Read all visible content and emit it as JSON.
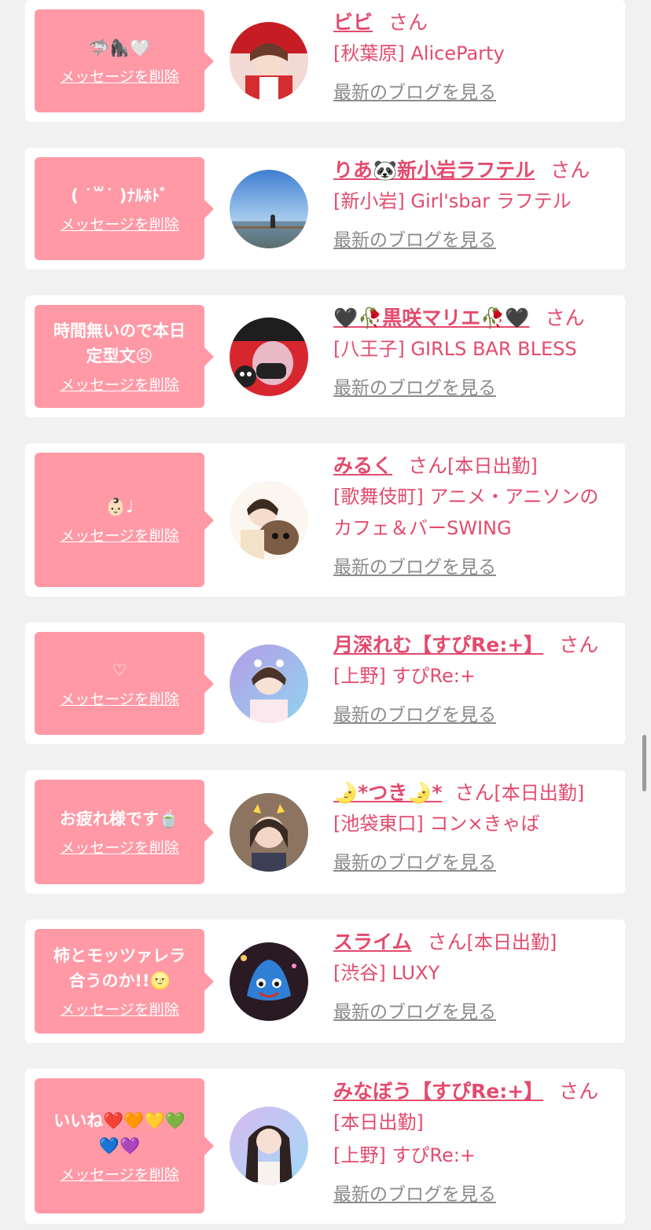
{
  "delete_label": "メッセージを削除",
  "blog_label": "最新のブログを見る",
  "san_label": "さん",
  "accent_color": "#e34b6e",
  "bubble_color": "#ff99a6",
  "messages": [
    {
      "bubble": "🦈🦍🤍",
      "name": "ビビ",
      "extra": "",
      "shop": "[秋葉原] AliceParty"
    },
    {
      "bubble": "( ˙꒳˙ )ﾅﾙﾎﾄﾞ",
      "name": "りあ🐼新小岩ラフテル",
      "extra": "",
      "shop": "[新小岩] Girl'sbar ラフテル"
    },
    {
      "bubble": "時間無いので本日\n定型文😣",
      "name": "🖤🥀黒咲マリエ🥀🖤",
      "extra": "",
      "shop": "[八王子] GIRLS BAR BLESS"
    },
    {
      "bubble": "👶🏻♩",
      "name": "みるく",
      "extra": "[本日出勤]",
      "shop": "[歌舞伎町] アニメ・アニソンのカフェ＆バーSWING"
    },
    {
      "bubble": "♡",
      "name": "月深れむ【すぴRe:+】",
      "extra": "",
      "shop": "[上野] すぴRe:+"
    },
    {
      "bubble": "お疲れ様です🍵",
      "name": "🌛*つき🌛*",
      "extra": "[本日出勤]",
      "shop": "[池袋東口] コン×きゃば"
    },
    {
      "bubble": "柿とモッツァレラ\n合うのか!!🌝",
      "name": "スライム",
      "extra": "[本日出勤]",
      "shop": "[渋谷] LUXY"
    },
    {
      "bubble": "いいね❤️🧡💛💚\n💙💜",
      "name": "みなぼう【すぴRe:+】",
      "extra": "[本日出勤]",
      "shop": "[上野] すぴRe:+"
    }
  ]
}
